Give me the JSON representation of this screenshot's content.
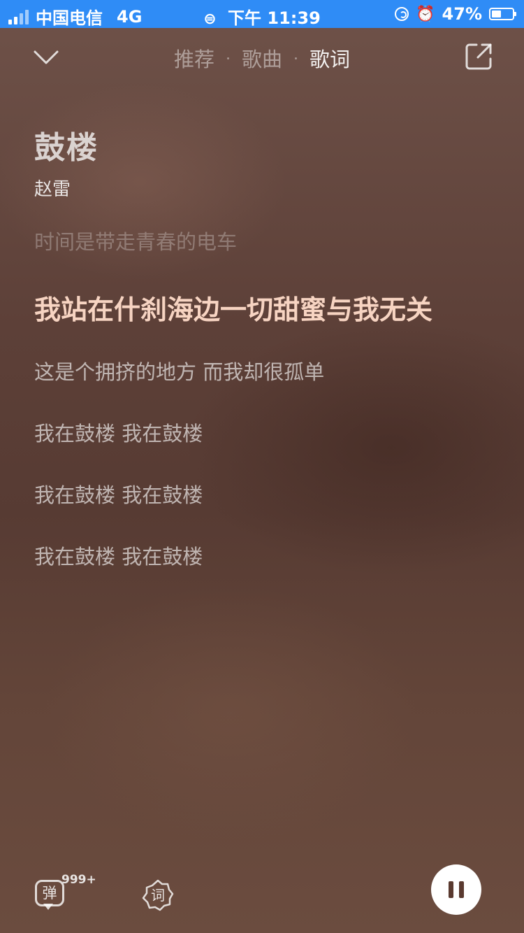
{
  "status_bar": {
    "carrier": "中国电信",
    "network": "4G",
    "time": "下午 11:39",
    "battery": "47%",
    "battery_level": 0.47
  },
  "nav": {
    "back_icon": "chevron-down-icon",
    "tabs": [
      {
        "label": "推荐",
        "active": false
      },
      {
        "label": "歌曲",
        "active": false
      },
      {
        "label": "歌词",
        "active": true
      }
    ],
    "share_icon": "share-icon"
  },
  "song": {
    "title": "鼓楼",
    "artist": "赵雷"
  },
  "lyrics": [
    {
      "text": "时间是带走青春的电车",
      "state": "past"
    },
    {
      "text": "我站在什刹海边一切甜蜜与我无关",
      "state": "current"
    },
    {
      "text": "这是个拥挤的地方 而我却很孤单",
      "state": "upcoming"
    },
    {
      "text": "我在鼓楼 我在鼓楼",
      "state": "upcoming"
    },
    {
      "text": "我在鼓楼 我在鼓楼",
      "state": "upcoming"
    },
    {
      "text": "我在鼓楼 我在鼓楼",
      "state": "upcoming"
    }
  ],
  "controls": {
    "danmu_label": "弹",
    "danmu_count": "999+",
    "lyric_label": "词",
    "pause_icon": "pause-icon"
  },
  "colors": {
    "status_bar": "#2f8cf6",
    "current_lyric": "#f7d4c2",
    "background": "#5d4038"
  }
}
